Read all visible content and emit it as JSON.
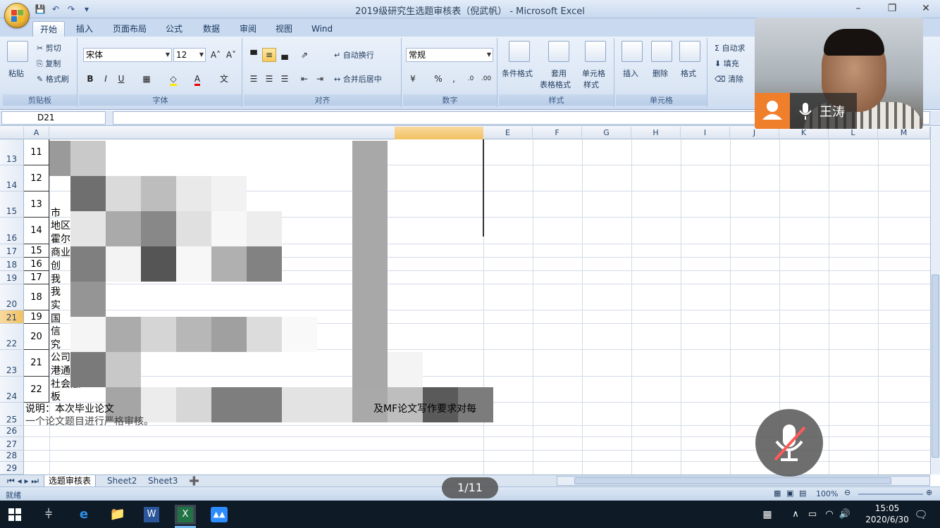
{
  "window": {
    "title": "2019级研究生选题审核表（倪武帆） - Microsoft Excel"
  },
  "ribbon_tabs": [
    "开始",
    "插入",
    "页面布局",
    "公式",
    "数据",
    "审阅",
    "视图",
    "Wind"
  ],
  "clipboard": {
    "paste": "粘贴",
    "cut": "剪切",
    "copy": "复制",
    "format_painter": "格式刷",
    "label": "剪贴板"
  },
  "font": {
    "family": "宋体",
    "size": "12",
    "label": "字体"
  },
  "alignment": {
    "wrap": "自动换行",
    "merge": "合并后居中",
    "label": "对齐"
  },
  "number": {
    "format": "常规",
    "label": "数字"
  },
  "styles": {
    "conditional": "条件格式",
    "table_1": "套用",
    "table_2": "表格格式",
    "cell_1": "单元格",
    "cell_2": "样式",
    "label": "样式"
  },
  "cells": {
    "insert": "插入",
    "delete": "删除",
    "format": "格式",
    "label": "单元格"
  },
  "editing": {
    "autosum": "自动求",
    "fill": "填充",
    "clear": "清除"
  },
  "formula_bar": {
    "name_box": "D21"
  },
  "columns": [
    "A",
    "E",
    "F",
    "G",
    "H",
    "I",
    "J",
    "K",
    "L",
    "M"
  ],
  "rows": [
    "13",
    "14",
    "15",
    "16",
    "17",
    "18",
    "19",
    "20",
    "21",
    "22",
    "23",
    "24",
    "25",
    "26",
    "27",
    "28",
    "29"
  ],
  "row_numbers": [
    "11",
    "12",
    "13",
    "14",
    "15",
    "16",
    "17",
    "18",
    "19",
    "20",
    "21",
    "22"
  ],
  "visible_fragments": [
    "市",
    "地区性",
    "霍尔",
    "商业",
    "创",
    "我",
    "我",
    "实",
    "国",
    "信",
    "究",
    "公司",
    "港通",
    "社会融",
    "板"
  ],
  "note": {
    "line1_left": "说明：本次毕业论文",
    "line1_right": "及MF论文写作要求对每",
    "line2": "一个论文题目进行严格审核。"
  },
  "sheet_tabs": [
    "选题审核表",
    "Sheet2",
    "Sheet3"
  ],
  "status": {
    "ready": "就绪",
    "zoom": "100%"
  },
  "overlay": {
    "pager": "1/11",
    "participant": "王涛"
  },
  "taskbar": {
    "time": "15:05",
    "date": "2020/6/30"
  }
}
